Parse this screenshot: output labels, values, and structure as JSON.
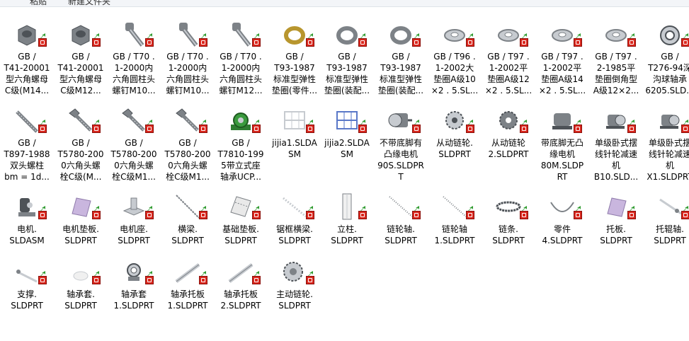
{
  "toolbar": {
    "left_label": "粘贴",
    "right_label": "新建文件夹"
  },
  "files": [
    {
      "label": "GB /\nT41-20001\n型六角螺母\nC级(M14...",
      "icon": "hex-nut-icon"
    },
    {
      "label": "GB /\nT41-20001\n型六角螺母\nC级M12...",
      "icon": "hex-nut-icon"
    },
    {
      "label": "GB / T70 .\n1-2000内\n六角圆柱头\n螺钉M10...",
      "icon": "socket-screw-icon"
    },
    {
      "label": "GB / T70 .\n1-2000内\n六角圆柱头\n螺钉M10...",
      "icon": "socket-screw-icon"
    },
    {
      "label": "GB / T70 .\n1-2000内\n六角圆柱头\n螺钉M12...",
      "icon": "socket-screw-icon"
    },
    {
      "label": "GB /\nT93-1987\n标准型弹性\n垫圈(零件...",
      "icon": "spring-washer-gold-icon"
    },
    {
      "label": "GB /\nT93-1987\n标准型弹性\n垫圈(装配...",
      "icon": "spring-washer-icon"
    },
    {
      "label": "GB /\nT93-1987\n标准型弹性\n垫圈(装配...",
      "icon": "spring-washer-icon"
    },
    {
      "label": "GB / T96 .\n1-2002大\n垫圈A级10\n×2 . 5.SL...",
      "icon": "flat-washer-icon"
    },
    {
      "label": "GB / T97 .\n1-2002平\n垫圈A级12\n×2 . 5.SL...",
      "icon": "flat-washer-icon"
    },
    {
      "label": "GB / T97 .\n1-2002平\n垫圈A级14\n×2 . 5.SL...",
      "icon": "flat-washer-icon"
    },
    {
      "label": "GB / T97 .\n2-1985平\n垫圈倒角型\nA级12×2...",
      "icon": "flat-washer-icon"
    },
    {
      "label": "GB /\nT276-94深\n沟球轴承\n6205.SLD...",
      "icon": "ball-bearing-icon"
    },
    {
      "label": "GB /\nT897-1988\n双头螺柱\nbm = 1d...",
      "icon": "stud-icon"
    },
    {
      "label": "GB /\nT5780-200\n0六角头螺\n栓C级(M...",
      "icon": "hex-bolt-icon"
    },
    {
      "label": "GB /\nT5780-200\n0六角头螺\n栓C级M1...",
      "icon": "hex-bolt-icon"
    },
    {
      "label": "GB /\nT5780-200\n0六角头螺\n栓C级M1...",
      "icon": "hex-bolt-icon"
    },
    {
      "label": "GB /\nT7810-199\n5带立式座\n轴承UCP...",
      "icon": "pillow-block-icon"
    },
    {
      "label": "jijia1.SLDA\nSM",
      "icon": "frame-assembly-icon"
    },
    {
      "label": "jijia2.SLDA\nSM",
      "icon": "frame-assembly-blue-icon"
    },
    {
      "label": "不带底脚有\n凸缘电机\n90S.SLDPR\nT",
      "icon": "flange-motor-icon"
    },
    {
      "label": "从动链轮.\nSLDPRT",
      "icon": "sprocket-icon"
    },
    {
      "label": "从动链轮\n2.SLDPRT",
      "icon": "sprocket-dark-icon"
    },
    {
      "label": "带底脚无凸\n缘电机\n80M.SLDP\nRT",
      "icon": "foot-motor-icon"
    },
    {
      "label": "单级卧式摆\n线针轮减速\n机\nB10.SLD...",
      "icon": "reducer-icon"
    },
    {
      "label": "单级卧式摆\n线针轮减速\n机\nX1.SLDPRT",
      "icon": "reducer-icon"
    },
    {
      "label": "电机.\nSLDASM",
      "icon": "motor-assembly-icon"
    },
    {
      "label": "电机垫板.\nSLDPRT",
      "icon": "plate-purple-icon"
    },
    {
      "label": "电机座.\nSLDPRT",
      "icon": "motor-base-icon"
    },
    {
      "label": "横梁.\nSLDPRT",
      "icon": "beam-icon"
    },
    {
      "label": "基础垫板.\nSLDPRT",
      "icon": "base-plate-icon"
    },
    {
      "label": "锯框横梁.\nSLDPRT",
      "icon": "saw-beam-icon"
    },
    {
      "label": "立柱.\nSLDPRT",
      "icon": "column-icon"
    },
    {
      "label": "链轮轴.\nSLDPRT",
      "icon": "shaft-icon"
    },
    {
      "label": "链轮轴\n1.SLDPRT",
      "icon": "shaft-icon"
    },
    {
      "label": "链条.\nSLDPRT",
      "icon": "chain-icon"
    },
    {
      "label": "零件\n4.SLDPRT",
      "icon": "arc-part-icon"
    },
    {
      "label": "托板.\nSLDPRT",
      "icon": "plate-purple-icon"
    },
    {
      "label": "托辊轴.\nSLDPRT",
      "icon": "roller-shaft-icon"
    },
    {
      "label": "支撑.\nSLDPRT",
      "icon": "support-icon"
    },
    {
      "label": "轴承套.\nSLDPRT",
      "icon": "bearing-sleeve-icon"
    },
    {
      "label": "轴承套\n1.SLDPRT",
      "icon": "bearing-sleeve-ring-icon"
    },
    {
      "label": "轴承托板\n1.SLDPRT",
      "icon": "bearing-plate-icon"
    },
    {
      "label": "轴承托板\n2.SLDPRT",
      "icon": "bearing-plate-icon"
    },
    {
      "label": "主动链轮.\nSLDPRT",
      "icon": "drive-sprocket-icon"
    }
  ],
  "colors": {
    "badge_red": "#d9261c",
    "arrow_green": "#2e9a2e"
  }
}
